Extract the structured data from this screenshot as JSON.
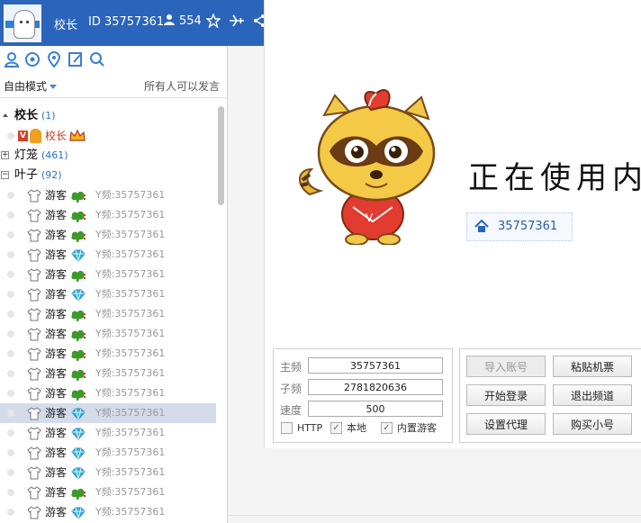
{
  "header": {
    "role": "校长",
    "id_text": "ID 35757361",
    "online_count": "554",
    "icons": [
      "avatar",
      "person-icon",
      "star-icon",
      "plane-icon",
      "share-icon"
    ]
  },
  "toolbar": {
    "icons": [
      "user-icon",
      "refresh-icon",
      "location-icon",
      "edit-icon",
      "search-icon"
    ]
  },
  "mode": {
    "selected": "自由模式",
    "hint": "所有人可以发言"
  },
  "tree": {
    "groups": [
      {
        "name": "校长",
        "count": "(1)",
        "expanded": false
      },
      {
        "name": "灯笼",
        "count": "(461)",
        "expanded": false
      },
      {
        "name": "叶子",
        "count": "(92)",
        "expanded": true
      }
    ],
    "principal_row": {
      "badge": "V",
      "name": "校长"
    },
    "users": [
      {
        "name": "游客",
        "gift": "tree",
        "id": "Y频:35757361"
      },
      {
        "name": "游客",
        "gift": "tree",
        "id": "Y频:35757361"
      },
      {
        "name": "游客",
        "gift": "tree",
        "id": "Y频:35757361"
      },
      {
        "name": "游客",
        "gift": "diamond",
        "id": "Y频:35757361"
      },
      {
        "name": "游客",
        "gift": "tree",
        "id": "Y频:35757361"
      },
      {
        "name": "游客",
        "gift": "diamond",
        "id": "Y频:35757361"
      },
      {
        "name": "游客",
        "gift": "tree",
        "id": "Y频:35757361"
      },
      {
        "name": "游客",
        "gift": "tree",
        "id": "Y频:35757361"
      },
      {
        "name": "游客",
        "gift": "tree",
        "id": "Y频:35757361"
      },
      {
        "name": "游客",
        "gift": "tree",
        "id": "Y频:35757361"
      },
      {
        "name": "游客",
        "gift": "tree",
        "id": "Y频:35757361"
      },
      {
        "name": "游客",
        "gift": "diamond",
        "id": "Y频:35757361",
        "selected": true
      },
      {
        "name": "游客",
        "gift": "diamond",
        "id": "Y频:35757361"
      },
      {
        "name": "游客",
        "gift": "diamond",
        "id": "Y频:35757361"
      },
      {
        "name": "游客",
        "gift": "diamond",
        "id": "Y频:35757361"
      },
      {
        "name": "游客",
        "gift": "tree",
        "id": "Y频:35757361"
      },
      {
        "name": "游客",
        "gift": "diamond",
        "id": "Y频:35757361"
      }
    ]
  },
  "main": {
    "status_text": "正在使用内",
    "room_id": "35757361"
  },
  "settings": {
    "main_label": "主频",
    "main_value": "35757361",
    "sub_label": "子频",
    "sub_value": "2781820636",
    "speed_label": "速度",
    "speed_value": "500",
    "checkboxes": [
      {
        "label": "HTTP",
        "checked": false
      },
      {
        "label": "本地",
        "checked": true
      },
      {
        "label": "内置游客",
        "checked": true
      }
    ]
  },
  "buttons": {
    "import": "导入账号",
    "paste": "粘贴机票",
    "start": "开始登录",
    "exit": "退出频道",
    "proxy": "设置代理",
    "buy": "购买小号"
  },
  "colors": {
    "header_bg": "#2b64bb",
    "selected_row": "#d4dcec",
    "count_blue": "#2a70c8"
  }
}
